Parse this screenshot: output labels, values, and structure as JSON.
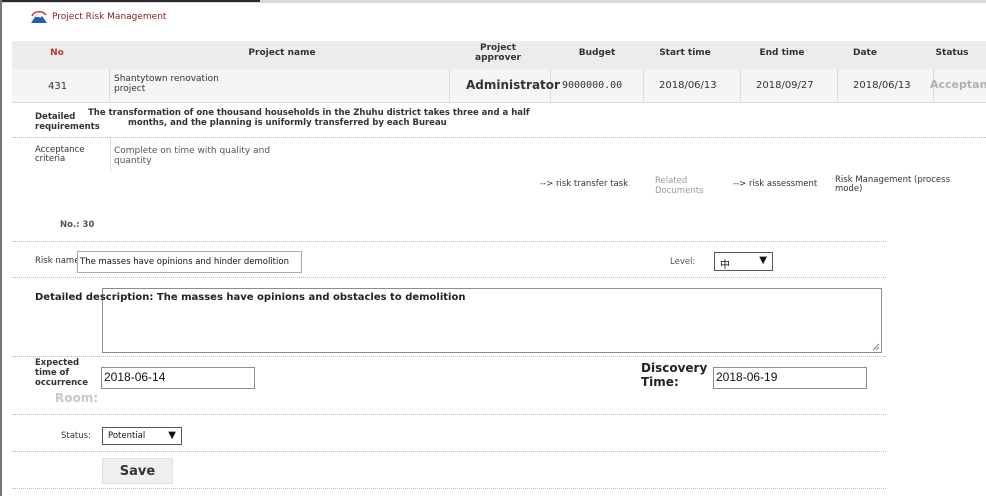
{
  "app": {
    "title": "Project Risk Management"
  },
  "table": {
    "headers": {
      "no": "No",
      "project_name": "Project name",
      "approver_line1": "Project",
      "approver_line2": "approver",
      "budget": "Budget",
      "start_time": "Start time",
      "end_time": "End time",
      "date": "Date",
      "status": "Status"
    },
    "row": {
      "no": "431",
      "project_name_line1": "Shantytown renovation",
      "project_name_line2": "project",
      "approver": "Administrator",
      "budget": "9000000.00",
      "start_time": "2018/06/13",
      "end_time": "2018/09/27",
      "date": "2018/06/13",
      "status": "Acceptanc"
    }
  },
  "requirements": {
    "label_line1": "Detailed",
    "label_line2": "requirements",
    "text_line1": "The transformation of one thousand households in the Zhuhu district takes three and a half",
    "text_line2": "months, and the planning is uniformly transferred by each Bureau"
  },
  "acceptance": {
    "label_line1": "Acceptance",
    "label_line2": "criteria",
    "text_line1": "Complete on time with quality and",
    "text_line2": "quantity"
  },
  "links": {
    "risk_transfer": "--> risk transfer task",
    "related_docs_line1": "Related",
    "related_docs_line2": "Documents",
    "risk_assessment": "--> risk assessment",
    "risk_mgmt_line1": "Risk Management (process",
    "risk_mgmt_line2": "mode)"
  },
  "form": {
    "number": "No.: 30",
    "risk_name_label": "Risk name:",
    "risk_name_value": "The masses have opinions and hinder demolition",
    "level_label": "Level:",
    "level_value": "中",
    "detailed_description": "Detailed description: The masses have opinions and obstacles to demolition",
    "expected_label_line1": "Expected",
    "expected_label_line2": "time of",
    "expected_label_line3": "occurrence",
    "expected_value": "2018-06-14",
    "room_label": "Room:",
    "discovery_label_line1": "Discovery",
    "discovery_label_line2": "Time:",
    "discovery_value": "2018-06-19",
    "status_label": "Status:",
    "status_value": "Potential",
    "save_label": "Save"
  },
  "colors": {
    "title_red": "#8b1a1a",
    "header_red": "#c0392b",
    "logo_blue": "#1f5fb0",
    "logo_red": "#d63a2a"
  }
}
